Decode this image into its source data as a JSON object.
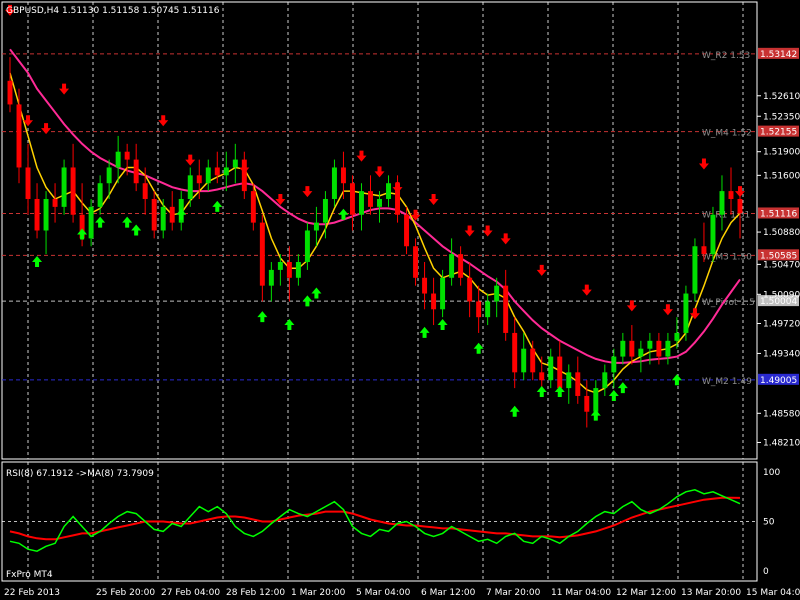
{
  "window": {
    "title": "GBPUSD,H4  1.51130 1.51158 1.50745 1.51116",
    "broker": "FxPro MT4"
  },
  "colors": {
    "background": "#000000",
    "bull": "#00e000",
    "bear": "#ff0000",
    "ma_slow": "#ff2a96",
    "ma_fast": "#ffd200",
    "rsi": "#00ff00",
    "rsi_ma": "#ff0000",
    "grid": "#ffffff",
    "pivot_line": "#c83232",
    "pivot_blue": "#2a2ad0",
    "arrow_up": "#00ff00",
    "arrow_down": "#ff0000"
  },
  "icons": {
    "buy_signal": "green-up-arrow",
    "sell_signal": "red-down-arrow"
  },
  "chart_data": [
    {
      "type": "candlestick",
      "symbol": "GBPUSD",
      "timeframe": "H4",
      "ylim": [
        1.48,
        1.538
      ],
      "y_ticks": [
        "1.52610",
        "1.52350",
        "1.51900",
        "1.51600",
        "1.50880",
        "1.50470",
        "1.50090",
        "1.49720",
        "1.49340",
        "1.48580",
        "1.48210"
      ],
      "x_ticks": [
        "22 Feb 2013",
        "25 Feb 20:00",
        "27 Feb 04:00",
        "28 Feb 12:00",
        "1 Mar 20:00",
        "5 Mar 04:00",
        "6 Mar 12:00",
        "7 Mar 20:00",
        "11 Mar 04:00",
        "12 Mar 12:00",
        "13 Mar 20:00",
        "15 Mar 04:00"
      ],
      "price_tags": [
        {
          "label": "1.53142",
          "value": 1.53142,
          "color": "#c83232"
        },
        {
          "label": "1.52155",
          "value": 1.52155,
          "color": "#c83232"
        },
        {
          "label": "1.51116",
          "value": 1.51116,
          "color": "#c83232"
        },
        {
          "label": "1.50585",
          "value": 1.50585,
          "color": "#c83232"
        },
        {
          "label": "1.50004",
          "value": 1.50004,
          "color": "#c0c0c0"
        },
        {
          "label": "1.49005",
          "value": 1.49005,
          "color": "#2a2ad0"
        }
      ],
      "pivot_levels": [
        {
          "label": "W_R2 1.53",
          "value": 1.53142,
          "color": "#c83232"
        },
        {
          "label": "W_M4 1.52",
          "value": 1.52155,
          "color": "#c83232"
        },
        {
          "label": "W_R1 1.51",
          "value": 1.51116,
          "color": "#c83232"
        },
        {
          "label": "W_M3 1.50",
          "value": 1.50585,
          "color": "#c83232"
        },
        {
          "label": "W_Pivot 1.5",
          "value": 1.50004,
          "color": "#c0c0c0"
        },
        {
          "label": "W_M2 1.49",
          "value": 1.49005,
          "color": "#2a2ad0"
        }
      ],
      "candles": [
        [
          1.528,
          1.531,
          1.524,
          1.525
        ],
        [
          1.525,
          1.527,
          1.515,
          1.517
        ],
        [
          1.517,
          1.52,
          1.511,
          1.513
        ],
        [
          1.513,
          1.515,
          1.508,
          1.509
        ],
        [
          1.509,
          1.514,
          1.506,
          1.513
        ],
        [
          1.513,
          1.515,
          1.51,
          1.512
        ],
        [
          1.512,
          1.518,
          1.511,
          1.517
        ],
        [
          1.517,
          1.52,
          1.51,
          1.511
        ],
        [
          1.511,
          1.515,
          1.507,
          1.508
        ],
        [
          1.508,
          1.513,
          1.507,
          1.512
        ],
        [
          1.512,
          1.516,
          1.511,
          1.515
        ],
        [
          1.515,
          1.518,
          1.513,
          1.517
        ],
        [
          1.517,
          1.521,
          1.515,
          1.519
        ],
        [
          1.519,
          1.52,
          1.516,
          1.518
        ],
        [
          1.518,
          1.52,
          1.514,
          1.515
        ],
        [
          1.515,
          1.517,
          1.511,
          1.513
        ],
        [
          1.513,
          1.514,
          1.508,
          1.509
        ],
        [
          1.509,
          1.513,
          1.508,
          1.512
        ],
        [
          1.512,
          1.514,
          1.509,
          1.51
        ],
        [
          1.51,
          1.514,
          1.509,
          1.513
        ],
        [
          1.513,
          1.517,
          1.512,
          1.516
        ],
        [
          1.516,
          1.518,
          1.513,
          1.515
        ],
        [
          1.515,
          1.518,
          1.514,
          1.517
        ],
        [
          1.517,
          1.519,
          1.515,
          1.516
        ],
        [
          1.516,
          1.519,
          1.514,
          1.517
        ],
        [
          1.517,
          1.52,
          1.515,
          1.518
        ],
        [
          1.518,
          1.519,
          1.513,
          1.514
        ],
        [
          1.514,
          1.515,
          1.509,
          1.51
        ],
        [
          1.51,
          1.511,
          1.5,
          1.502
        ],
        [
          1.502,
          1.505,
          1.5,
          1.504
        ],
        [
          1.504,
          1.506,
          1.502,
          1.505
        ],
        [
          1.505,
          1.507,
          1.5,
          1.503
        ],
        [
          1.503,
          1.506,
          1.502,
          1.505
        ],
        [
          1.505,
          1.51,
          1.504,
          1.509
        ],
        [
          1.509,
          1.512,
          1.507,
          1.51
        ],
        [
          1.51,
          1.514,
          1.508,
          1.513
        ],
        [
          1.513,
          1.518,
          1.512,
          1.517
        ],
        [
          1.517,
          1.519,
          1.513,
          1.515
        ],
        [
          1.515,
          1.516,
          1.509,
          1.511
        ],
        [
          1.511,
          1.515,
          1.509,
          1.514
        ],
        [
          1.514,
          1.516,
          1.511,
          1.512
        ],
        [
          1.512,
          1.514,
          1.51,
          1.513
        ],
        [
          1.513,
          1.516,
          1.512,
          1.515
        ],
        [
          1.515,
          1.516,
          1.51,
          1.511
        ],
        [
          1.511,
          1.512,
          1.506,
          1.507
        ],
        [
          1.507,
          1.508,
          1.502,
          1.503
        ],
        [
          1.503,
          1.505,
          1.499,
          1.501
        ],
        [
          1.501,
          1.503,
          1.497,
          1.499
        ],
        [
          1.499,
          1.504,
          1.498,
          1.503
        ],
        [
          1.503,
          1.508,
          1.502,
          1.506
        ],
        [
          1.506,
          1.507,
          1.502,
          1.503
        ],
        [
          1.503,
          1.505,
          1.498,
          1.5
        ],
        [
          1.5,
          1.502,
          1.496,
          1.498
        ],
        [
          1.498,
          1.501,
          1.497,
          1.5
        ],
        [
          1.5,
          1.503,
          1.498,
          1.502
        ],
        [
          1.502,
          1.504,
          1.495,
          1.496
        ],
        [
          1.496,
          1.498,
          1.489,
          1.491
        ],
        [
          1.491,
          1.496,
          1.49,
          1.494
        ],
        [
          1.494,
          1.495,
          1.49,
          1.491
        ],
        [
          1.491,
          1.493,
          1.488,
          1.49
        ],
        [
          1.49,
          1.494,
          1.489,
          1.493
        ],
        [
          1.493,
          1.495,
          1.488,
          1.489
        ],
        [
          1.489,
          1.492,
          1.487,
          1.491
        ],
        [
          1.491,
          1.493,
          1.487,
          1.488
        ],
        [
          1.488,
          1.49,
          1.484,
          1.486
        ],
        [
          1.486,
          1.49,
          1.485,
          1.489
        ],
        [
          1.489,
          1.492,
          1.488,
          1.491
        ],
        [
          1.491,
          1.494,
          1.489,
          1.493
        ],
        [
          1.493,
          1.496,
          1.492,
          1.495
        ],
        [
          1.495,
          1.497,
          1.492,
          1.493
        ],
        [
          1.493,
          1.495,
          1.491,
          1.494
        ],
        [
          1.494,
          1.496,
          1.492,
          1.495
        ],
        [
          1.495,
          1.496,
          1.492,
          1.493
        ],
        [
          1.493,
          1.496,
          1.492,
          1.495
        ],
        [
          1.495,
          1.498,
          1.494,
          1.496
        ],
        [
          1.496,
          1.502,
          1.495,
          1.501
        ],
        [
          1.501,
          1.508,
          1.5,
          1.507
        ],
        [
          1.507,
          1.51,
          1.505,
          1.506
        ],
        [
          1.506,
          1.512,
          1.505,
          1.511
        ],
        [
          1.511,
          1.516,
          1.509,
          1.514
        ],
        [
          1.514,
          1.517,
          1.511,
          1.513
        ],
        [
          1.513,
          1.514,
          1.508,
          1.5112
        ]
      ],
      "ma_slow": [
        1.532,
        1.5305,
        1.529,
        1.527,
        1.5255,
        1.524,
        1.5225,
        1.5212,
        1.52,
        1.519,
        1.5182,
        1.5176,
        1.517,
        1.5166,
        1.5163,
        1.516,
        1.5155,
        1.515,
        1.5145,
        1.5142,
        1.514,
        1.514,
        1.514,
        1.5142,
        1.5145,
        1.5148,
        1.515,
        1.5148,
        1.514,
        1.513,
        1.512,
        1.5112,
        1.5105,
        1.51,
        1.5098,
        1.5098,
        1.51,
        1.5104,
        1.5108,
        1.5112,
        1.5116,
        1.5118,
        1.5118,
        1.5116,
        1.511,
        1.51,
        1.509,
        1.508,
        1.507,
        1.5062,
        1.5055,
        1.5048,
        1.504,
        1.5032,
        1.5025,
        1.5015,
        1.5,
        1.4988,
        1.4976,
        1.4966,
        1.4958,
        1.495,
        1.4944,
        1.4938,
        1.4932,
        1.4927,
        1.4924,
        1.4922,
        1.4922,
        1.4923,
        1.4924,
        1.4926,
        1.4927,
        1.4928,
        1.493,
        1.4936,
        1.4948,
        1.4962,
        1.4978,
        1.4996,
        1.5012,
        1.5028
      ],
      "ma_fast": [
        1.529,
        1.525,
        1.521,
        1.517,
        1.5145,
        1.513,
        1.5135,
        1.514,
        1.5125,
        1.5112,
        1.5118,
        1.5135,
        1.5155,
        1.517,
        1.517,
        1.516,
        1.514,
        1.5122,
        1.511,
        1.5112,
        1.5128,
        1.514,
        1.5152,
        1.5158,
        1.5163,
        1.517,
        1.5168,
        1.5148,
        1.5115,
        1.508,
        1.5055,
        1.5042,
        1.5042,
        1.5052,
        1.507,
        1.5092,
        1.5118,
        1.514,
        1.514,
        1.5138,
        1.5136,
        1.5134,
        1.5138,
        1.5136,
        1.512,
        1.5096,
        1.5068,
        1.5042,
        1.503,
        1.5034,
        1.5038,
        1.503,
        1.5016,
        1.5008,
        1.501,
        1.5004,
        1.498,
        1.4962,
        1.494,
        1.4922,
        1.4918,
        1.4912,
        1.4906,
        1.4898,
        1.4888,
        1.4884,
        1.489,
        1.49,
        1.4914,
        1.4924,
        1.493,
        1.4936,
        1.4938,
        1.494,
        1.4946,
        1.496,
        1.499,
        1.502,
        1.5052,
        1.508,
        1.51,
        1.5112
      ],
      "buy_arrows": [
        [
          3,
          1.505
        ],
        [
          8,
          1.5085
        ],
        [
          10,
          1.51
        ],
        [
          13,
          1.51
        ],
        [
          14,
          1.509
        ],
        [
          19,
          1.511
        ],
        [
          23,
          1.512
        ],
        [
          28,
          1.498
        ],
        [
          31,
          1.497
        ],
        [
          33,
          1.5
        ],
        [
          34,
          1.501
        ],
        [
          37,
          1.511
        ],
        [
          46,
          1.496
        ],
        [
          48,
          1.497
        ],
        [
          52,
          1.494
        ],
        [
          56,
          1.486
        ],
        [
          59,
          1.4885
        ],
        [
          61,
          1.4885
        ],
        [
          65,
          1.4855
        ],
        [
          67,
          1.488
        ],
        [
          68,
          1.489
        ],
        [
          74,
          1.49
        ]
      ],
      "sell_arrows": [
        [
          0,
          1.537
        ],
        [
          6,
          1.527
        ],
        [
          2,
          1.523
        ],
        [
          4,
          1.522
        ],
        [
          17,
          1.523
        ],
        [
          20,
          1.518
        ],
        [
          26,
          1.517
        ],
        [
          30,
          1.513
        ],
        [
          33,
          1.514
        ],
        [
          39,
          1.5185
        ],
        [
          41,
          1.5165
        ],
        [
          43,
          1.5145
        ],
        [
          45,
          1.511
        ],
        [
          47,
          1.513
        ],
        [
          51,
          1.509
        ],
        [
          53,
          1.509
        ],
        [
          55,
          1.508
        ],
        [
          59,
          1.504
        ],
        [
          64,
          1.5015
        ],
        [
          69,
          1.4995
        ],
        [
          73,
          1.499
        ],
        [
          76,
          1.4985
        ],
        [
          77,
          1.5175
        ],
        [
          81,
          1.514
        ]
      ]
    },
    {
      "type": "line",
      "indicator": "RSI",
      "title": "RSI(8) 67.1912  ->MA(8) 73.7909",
      "ylim": [
        0,
        100
      ],
      "y_ticks": [
        "100",
        "50",
        "0"
      ],
      "series": [
        {
          "name": "RSI(8)",
          "values": [
            30,
            28,
            22,
            20,
            25,
            28,
            45,
            55,
            45,
            35,
            40,
            48,
            55,
            60,
            58,
            50,
            42,
            40,
            48,
            45,
            55,
            65,
            60,
            65,
            58,
            45,
            38,
            35,
            40,
            48,
            55,
            62,
            58,
            55,
            60,
            65,
            70,
            62,
            45,
            38,
            35,
            42,
            40,
            48,
            50,
            45,
            38,
            35,
            38,
            45,
            40,
            35,
            30,
            32,
            28,
            35,
            38,
            30,
            28,
            35,
            32,
            28,
            35,
            40,
            48,
            55,
            60,
            58,
            65,
            70,
            62,
            58,
            62,
            68,
            75,
            80,
            82,
            78,
            80,
            76,
            72,
            68
          ]
        },
        {
          "name": "->MA(8)",
          "values": [
            40,
            38,
            35,
            33,
            32,
            32,
            34,
            36,
            38,
            38,
            40,
            42,
            44,
            46,
            48,
            50,
            50,
            50,
            49,
            48,
            48,
            50,
            52,
            54,
            55,
            55,
            54,
            52,
            50,
            50,
            52,
            54,
            56,
            57,
            58,
            60,
            60,
            60,
            58,
            55,
            52,
            50,
            48,
            47,
            46,
            46,
            45,
            44,
            43,
            43,
            42,
            41,
            40,
            39,
            38,
            38,
            37,
            36,
            35,
            35,
            35,
            34,
            35,
            36,
            38,
            40,
            43,
            46,
            50,
            54,
            57,
            60,
            62,
            64,
            66,
            68,
            70,
            72,
            73,
            74,
            74,
            73.8
          ]
        }
      ]
    }
  ]
}
